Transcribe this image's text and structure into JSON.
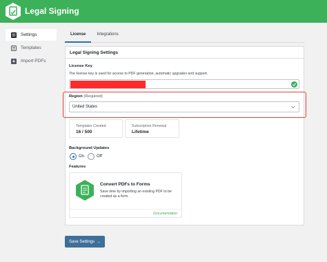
{
  "app": {
    "title": "Legal Signing"
  },
  "sidebar": {
    "items": [
      {
        "label": "Settings",
        "icon": "settings-icon",
        "active": true
      },
      {
        "label": "Templates",
        "icon": "templates-icon",
        "active": false
      },
      {
        "label": "Import PDFs",
        "icon": "import-icon",
        "active": false
      }
    ]
  },
  "tabs": [
    {
      "label": "License",
      "active": true
    },
    {
      "label": "Integrations",
      "active": false
    }
  ],
  "panel": {
    "title": "Legal Signing Settings",
    "license": {
      "label": "License Key",
      "help": "The license key is used for access to PDF generation, automatic upgrades and support.",
      "status_icon": "check-circle-icon"
    },
    "region": {
      "label": "Region",
      "required": "(Required)",
      "value": "United States"
    },
    "stats": [
      {
        "label": "Templates Created",
        "value": "16 / 500"
      },
      {
        "label": "Subscription Renewal",
        "value": "Lifetime"
      }
    ],
    "background_updates": {
      "label": "Background Updates",
      "options": [
        {
          "label": "On",
          "selected": true
        },
        {
          "label": "Off",
          "selected": false
        }
      ]
    },
    "features": {
      "label": "Features",
      "card": {
        "title": "Convert PDFs to Forms",
        "description": "Save time by importing an existing PDF to be created as a form.",
        "link": "Documentation",
        "icon": "convert-pdf-icon"
      }
    }
  },
  "save_button": {
    "label": "Save Settings",
    "arrow": "→"
  },
  "colors": {
    "brand": "#3cb15a",
    "accent": "#2271b1",
    "highlight": "#e14040",
    "redaction": "#ff2a2a",
    "save_button": "#3f6f97"
  }
}
